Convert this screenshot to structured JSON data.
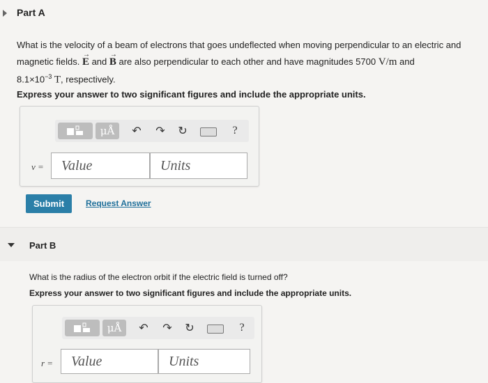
{
  "partA": {
    "title": "Part A",
    "question_line1": "What is the velocity of a beam of electrons that goes undeflected when moving perpendicular to an electric and",
    "q2_pre": "magnetic fields. ",
    "vecE": "E",
    "q2_mid": " and ",
    "vecB": "B",
    "q2_post": " are also perpendicular to each other and have magnitudes 5700 ",
    "q2_unit": "V/m",
    "q2_end": " and",
    "q3_base": "8.1×10",
    "q3_exp": "−3",
    "q3_unit": " T",
    "q3_end": ", respectively.",
    "instruction": "Express your answer to two significant figures and include the appropriate units.",
    "variable": "v =",
    "value_placeholder": "Value",
    "units_placeholder": "Units",
    "submit": "Submit",
    "request": "Request Answer"
  },
  "partB": {
    "title": "Part B",
    "question": "What is the radius of the electron orbit if the electric field is turned off?",
    "instruction": "Express your answer to two significant figures and include the appropriate units.",
    "variable": "r =",
    "value_placeholder": "Value",
    "units_placeholder": "Units"
  },
  "toolbar": {
    "mu_label": "μÅ",
    "help_label": "?"
  }
}
